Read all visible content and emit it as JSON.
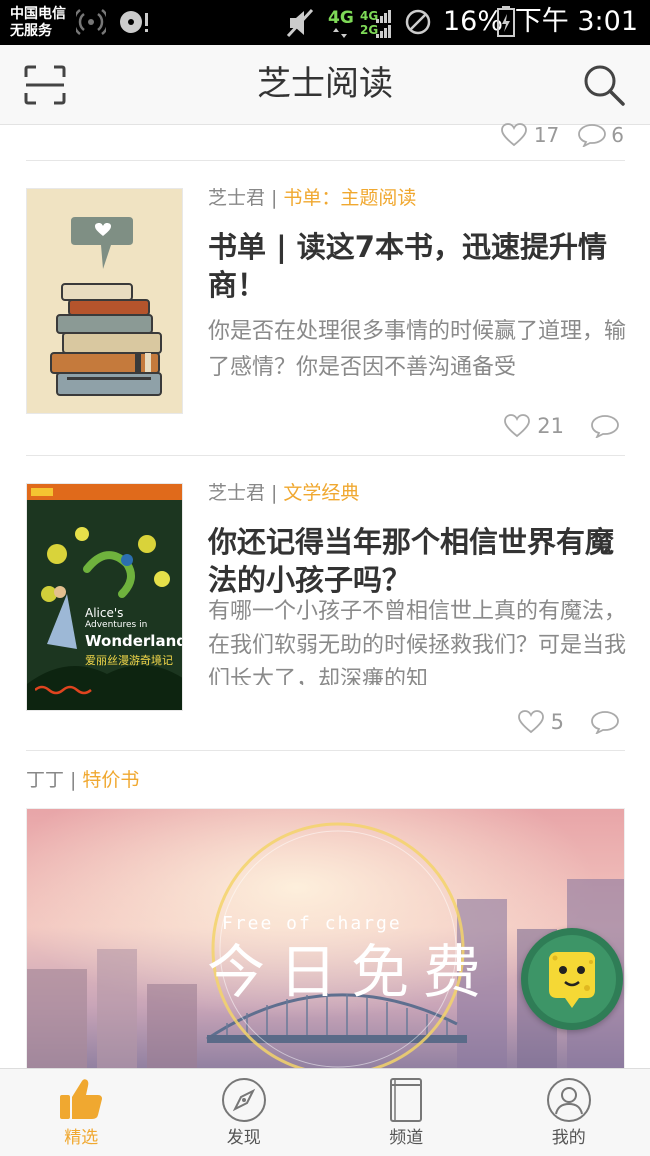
{
  "status_bar": {
    "carrier_line1": "中国电信",
    "carrier_line2": "无服务",
    "network_4g": "4G",
    "network_4g_small": "4G",
    "network_2g": "2G",
    "battery_percent": "16%",
    "time": "下午 3:01"
  },
  "header": {
    "title": "芝士阅读",
    "scan_icon": "scan-icon",
    "search_icon": "search-icon"
  },
  "previous_item": {
    "likes": "17",
    "comments": "6"
  },
  "feed": [
    {
      "author": "芝士君",
      "separator": "|",
      "category": "书单：主题阅读",
      "title": "书单 | 读这7本书，迅速提升情商！",
      "excerpt": "你是否在处理很多事情的时候赢了道理，输了感情？你是否因不善沟通备受",
      "likes": "21",
      "comments": ""
    },
    {
      "author": "芝士君",
      "separator": "|",
      "category": "文学经典",
      "title": "你还记得当年那个相信世界有魔法的小孩子吗？",
      "excerpt": "有哪一个小孩子不曾相信世上真的有魔法，在我们软弱无助的时候拯救我们？可是当我们长大了，却深㾾的知",
      "likes": "5",
      "comments": "",
      "cover_text_1": "Alice's",
      "cover_text_2": "Adventures in",
      "cover_text_3": "Wonderland",
      "cover_text_4": "爱丽丝漫游奇境记"
    }
  ],
  "banner_post": {
    "author": "丁丁",
    "separator": "|",
    "category": "特价书",
    "subtitle": "Free of charge",
    "title": "今日免费"
  },
  "bottom_nav": [
    {
      "label": "精选",
      "icon": "thumbs-up-icon",
      "active": true
    },
    {
      "label": "发现",
      "icon": "compass-icon",
      "active": false
    },
    {
      "label": "频道",
      "icon": "book-icon",
      "active": false
    },
    {
      "label": "我的",
      "icon": "user-icon",
      "active": false
    }
  ],
  "colors": {
    "accent": "#f0a830",
    "text": "#333333",
    "muted": "#999999"
  }
}
